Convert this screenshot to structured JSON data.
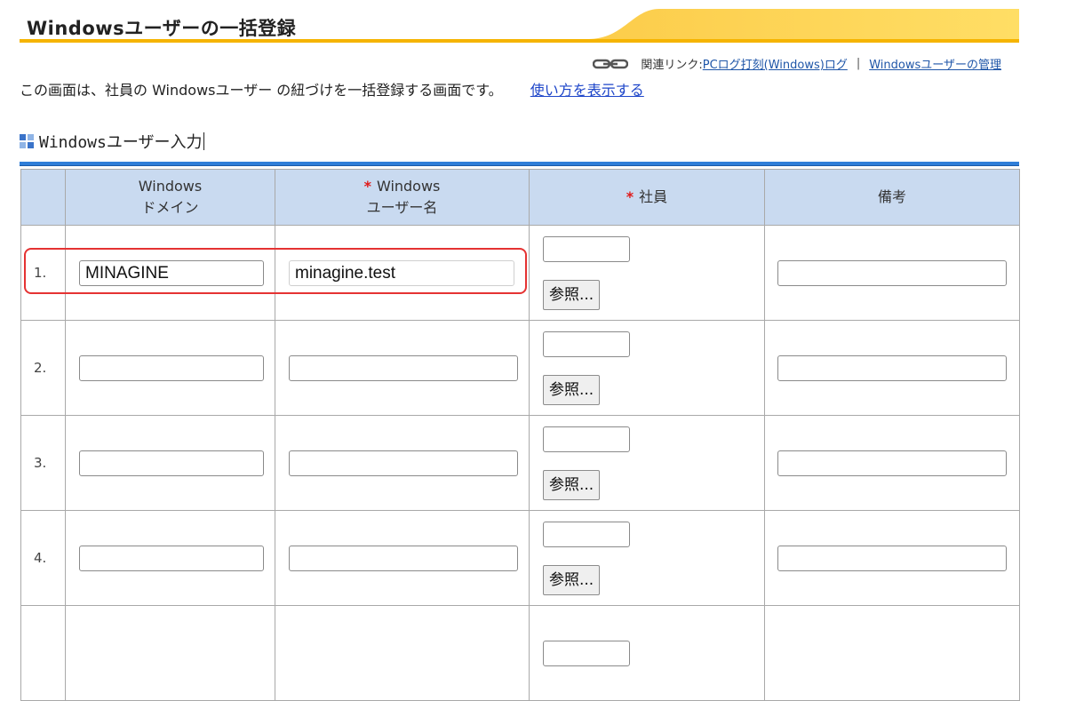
{
  "header": {
    "title": "Windowsユーザーの一括登録"
  },
  "related_links": {
    "label": "関連リンク:",
    "link1": "PCログ打刻(Windows)ログ",
    "separator": "|",
    "link2": "Windowsユーザーの管理"
  },
  "intro": {
    "text": "この画面は、社員の Windowsユーザー の紐づけを一括登録する画面です。",
    "help_link": "使い方を表示する"
  },
  "section": {
    "title": "Windowsユーザー入力"
  },
  "table": {
    "headers": {
      "domain_line1": "Windows",
      "domain_line2": "ドメイン",
      "user_line1": "Windows",
      "user_line2": "ユーザー名",
      "employee": "社員",
      "note": "備考",
      "required_mark": "*"
    },
    "rows": [
      {
        "num": "1.",
        "domain": "MINAGINE",
        "username": "minagine.test",
        "employee": "",
        "note": "",
        "ref_label": "参照..."
      },
      {
        "num": "2.",
        "domain": "",
        "username": "",
        "employee": "",
        "note": "",
        "ref_label": "参照..."
      },
      {
        "num": "3.",
        "domain": "",
        "username": "",
        "employee": "",
        "note": "",
        "ref_label": "参照..."
      },
      {
        "num": "4.",
        "domain": "",
        "username": "",
        "employee": "",
        "note": "",
        "ref_label": "参照..."
      }
    ]
  },
  "colors": {
    "header_bg": "#c9daf0",
    "accent_line": "#2f7ed8",
    "required": "#e01919",
    "highlight": "#e53232",
    "title_gradient": "#f5b400"
  }
}
